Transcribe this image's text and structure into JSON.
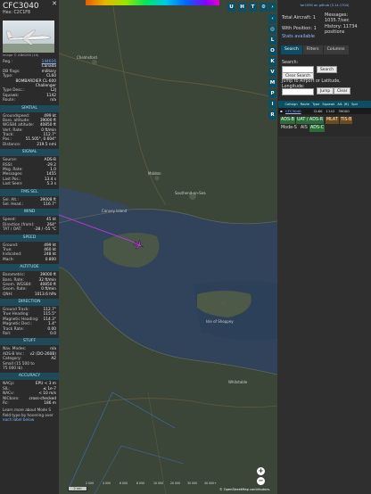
{
  "info": {
    "callsign": "CFC3040",
    "hex_line": "Hex: C2C1F8",
    "close": "✕",
    "photo_credit": "Image © ANKUS8 (16)",
    "details": [
      {
        "k": "Reg.:",
        "v": "144616",
        "link": true
      },
      {
        "k": "",
        "v": "Canada"
      },
      {
        "k": "DB flags:",
        "v": "military"
      },
      {
        "k": "Type:",
        "v": "CL60"
      },
      {
        "k": "",
        "v": "BOMBARDIER CL-600"
      },
      {
        "k": "",
        "v": "Challenger"
      },
      {
        "k": "Type Desc.:",
        "v": "L2J"
      },
      {
        "k": "Squawk:",
        "v": "1142"
      },
      {
        "k": "Route:",
        "v": "n/a"
      }
    ],
    "sections": [
      {
        "title": "SPATIAL",
        "rows": [
          {
            "k": "Groundspeed:",
            "v": "499 kt"
          },
          {
            "k": "Baro. altitude:",
            "v": "39000 ft"
          },
          {
            "k": "WGS84 altitude:",
            "v": "40850 ft"
          },
          {
            "k": "Vert. Rate:",
            "v": "0 ft/min"
          },
          {
            "k": "Track:",
            "v": "112.7°"
          },
          {
            "k": "Pos.:",
            "v": "51.505°, 0.604°"
          },
          {
            "k": "Distance:",
            "v": "219.5 nmi"
          }
        ]
      },
      {
        "title": "SIGNAL",
        "rows": [
          {
            "k": "Source:",
            "v": "ADS-B"
          },
          {
            "k": "RSSI:",
            "v": "-29.2"
          },
          {
            "k": "Msg. Rate:",
            "v": "1.0"
          },
          {
            "k": "Messages:",
            "v": "1455"
          },
          {
            "k": "Last Pos.:",
            "v": "13.4 s"
          },
          {
            "k": "Last Seen:",
            "v": "5.3 s"
          }
        ]
      },
      {
        "title": "FMS SEL",
        "rows": [
          {
            "k": "Sel. Alt.:",
            "v": "39008 ft"
          },
          {
            "k": "Sel. Head.:",
            "v": "116.7°"
          }
        ]
      },
      {
        "title": "WIND",
        "rows": [
          {
            "k": "Speed:",
            "v": "45 kt"
          },
          {
            "k": "Direction (from):",
            "v": "264°"
          },
          {
            "k": "TAT / OAT:",
            "v": "-28 / -55 °C"
          }
        ]
      },
      {
        "title": "SPEED",
        "rows": [
          {
            "k": "Ground:",
            "v": "499 kt"
          },
          {
            "k": "True:",
            "v": "460 kt"
          },
          {
            "k": "Indicated:",
            "v": "248 kt"
          },
          {
            "k": "Mach:",
            "v": "0.800"
          }
        ]
      },
      {
        "title": "ALTITUDE",
        "rows": [
          {
            "k": "Barometric:",
            "v": "39000 ft"
          },
          {
            "k": "Baro. Rate:",
            "v": "32 ft/min"
          },
          {
            "k": "Geom. WGS84:",
            "v": "40850 ft"
          },
          {
            "k": "Geom. Rate:",
            "v": "0 ft/min"
          },
          {
            "k": "QNH:",
            "v": "1013.6 hPa"
          }
        ]
      },
      {
        "title": "DIRECTION",
        "rows": [
          {
            "k": "Ground Track:",
            "v": "112.7°"
          },
          {
            "k": "True Heading:",
            "v": "115.5°"
          },
          {
            "k": "Magnetic Heading:",
            "v": "114.3°"
          },
          {
            "k": "Magnetic Decl.:",
            "v": "1.4°"
          },
          {
            "k": "Track Rate:",
            "v": "0.00"
          },
          {
            "k": "Roll:",
            "v": "0.0"
          }
        ]
      },
      {
        "title": "STUFF",
        "rows": [
          {
            "k": "Nav. Modes:",
            "v": "n/a"
          },
          {
            "k": "ADS-B Ver.:",
            "v": "v2 (DO-260B)"
          },
          {
            "k": "Category:",
            "v": "A2"
          },
          {
            "k": "Small (15 500 to",
            "v": ""
          },
          {
            "k": "75 000 lb)",
            "v": ""
          }
        ]
      },
      {
        "title": "ACCURACY",
        "rows": [
          {
            "k": "NACp:",
            "v": "EPU < 3 m"
          },
          {
            "k": "SIL:",
            "v": "≤ 1e-7"
          },
          {
            "k": "NACv:",
            "v": "< 10 m/s"
          },
          {
            "k": "NICbaro:",
            "v": "cross-checked"
          },
          {
            "k": "Rc:",
            "v": "186 m"
          }
        ]
      }
    ],
    "learn_text": "Learn more about Mode S",
    "learn_text2": "field type by hovering over",
    "learn_link": "each label below"
  },
  "map": {
    "top_buttons": [
      "U",
      "H",
      "T"
    ],
    "side_buttons": [
      "L",
      "O",
      "K",
      "V",
      "M",
      "P",
      "I",
      "R"
    ],
    "zoom_in": "+",
    "zoom_out": "−",
    "scale_label": "2 nm",
    "attribution_prefix": "© ",
    "attribution_link": "OpenStreetMap",
    "attribution_suffix": " contributors.",
    "alt_labels": [
      "2 000",
      "4 000",
      "6 000",
      "8 000",
      "10 000",
      "20 000",
      "30 000",
      "40 000+"
    ],
    "places": [
      "Chelmsford",
      "Maldon",
      "Southend-on-Sea",
      "Canvey Island",
      "Isle of Sheppey",
      "Whitstable"
    ],
    "aircraft_color": "#b23bd6"
  },
  "right": {
    "repo_link": "tar1090 on github (3.14.1704)",
    "stats": {
      "total_aircraft": "Total Aircraft: 1",
      "with_position": "With Position: 1",
      "stats_available": "Stats available",
      "messages": "Messages: 1035.7/sec",
      "history": "History: 11734 positions"
    },
    "tabs": [
      "Search",
      "Filters",
      "Columns"
    ],
    "search_label": "Search:",
    "search_button": "Search",
    "clear_search": "Clear Search",
    "jump_label": "Jump to Airport or Latitude, Longitude:",
    "jump_button": "Jump",
    "clear_button": "Clear",
    "table_headers": [
      "Callsign",
      "Route",
      "Type",
      "Squawk",
      "Alt. (ft)",
      "Spd"
    ],
    "table_row": [
      "CFC3040",
      "",
      "CL60",
      "1142",
      "39000",
      ""
    ],
    "chips": {
      "adsb": "ADS-B",
      "uat": "UAT / ADS-R",
      "mlat": "MLAT",
      "tisb": "TIS-B",
      "modes": "Mode-S",
      "ais": "AIS",
      "adsc": "ADS-C"
    }
  }
}
